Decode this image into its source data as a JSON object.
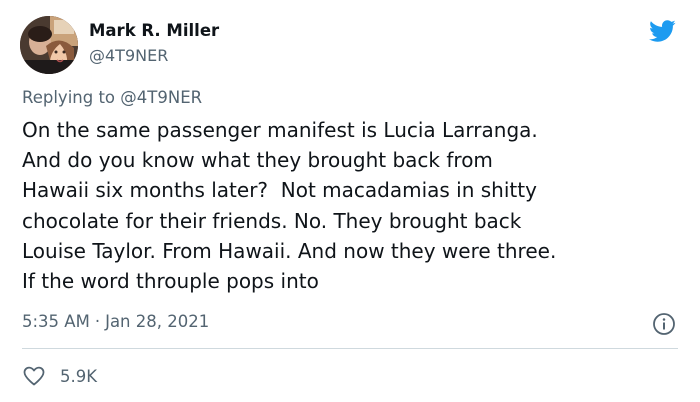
{
  "author": {
    "name": "Mark R. Miller",
    "handle": "@4T9NER",
    "avatar_icon": "profile-photo"
  },
  "platform_icon": "twitter-bird-icon",
  "brand_color": "#1d9bf0",
  "reply_context": {
    "prefix": "Replying to",
    "mention": "@4T9NER"
  },
  "tweet": {
    "lines": [
      "On the same passenger manifest is Lucia Larranga.",
      "And do you know what they brought back from",
      "Hawaii six months later?  Not macadamias in shitty",
      "chocolate for their friends. No. They brought back",
      "Louise Taylor. From Hawaii. And now they were three.",
      "If the word throuple pops into"
    ]
  },
  "meta": {
    "time": "5:35 AM",
    "separator": "·",
    "date": "Jan 28, 2021",
    "info_icon": "info-icon"
  },
  "actions": {
    "like_icon": "heart-icon",
    "like_count": "5.9K"
  }
}
